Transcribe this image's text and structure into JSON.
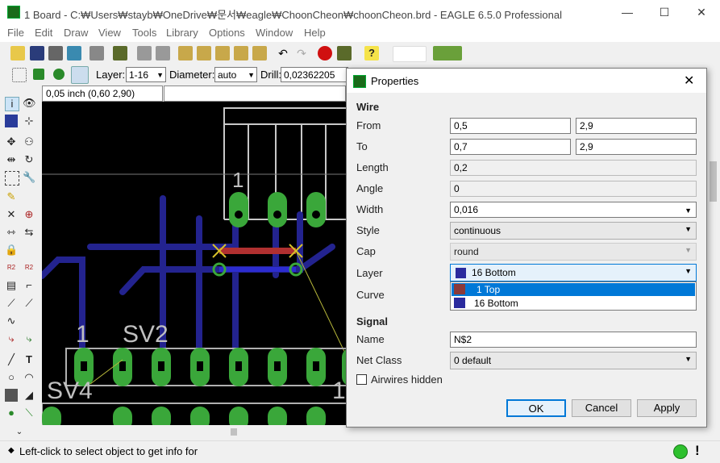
{
  "window": {
    "title": "1 Board - C:₩Users₩stayb₩OneDrive₩문서₩eagle₩ChoonCheon₩choonCheon.brd - EAGLE 6.5.0 Professional"
  },
  "menu": [
    "File",
    "Edit",
    "Draw",
    "View",
    "Tools",
    "Library",
    "Options",
    "Window",
    "Help"
  ],
  "toolbar2": {
    "layer_label": "Layer:",
    "layer_value": "1-16",
    "diameter_label": "Diameter:",
    "diameter_value": "auto",
    "drill_label": "Drill:",
    "drill_value": "0,02362205"
  },
  "coord": "0,05 inch (0,60 2,90)",
  "canvas": {
    "labels": [
      "1",
      "SV2",
      "1",
      "SV4",
      "1"
    ]
  },
  "status": {
    "text": "Left-click to select object to get info for"
  },
  "dialog": {
    "title": "Properties",
    "wire_section": "Wire",
    "from_label": "From",
    "from_x": "0,5",
    "from_y": "2,9",
    "to_label": "To",
    "to_x": "0,7",
    "to_y": "2,9",
    "length_label": "Length",
    "length": "0,2",
    "angle_label": "Angle",
    "angle": "0",
    "width_label": "Width",
    "width": "0,016",
    "style_label": "Style",
    "style": "continuous",
    "cap_label": "Cap",
    "cap": "round",
    "layer_label": "Layer",
    "layer": "16 Bottom",
    "layer_options": [
      "1 Top",
      "16 Bottom"
    ],
    "curve_label": "Curve",
    "signal_section": "Signal",
    "name_label": "Name",
    "name": "N$2",
    "netclass_label": "Net Class",
    "netclass": "0 default",
    "airwires_label": "Airwires hidden",
    "ok": "OK",
    "cancel": "Cancel",
    "apply": "Apply"
  },
  "colors": {
    "bottom_layer": "#2b2b9e",
    "top_layer": "#8b3a3a",
    "pad": "#3aa73a",
    "selection": "#0078d7"
  }
}
